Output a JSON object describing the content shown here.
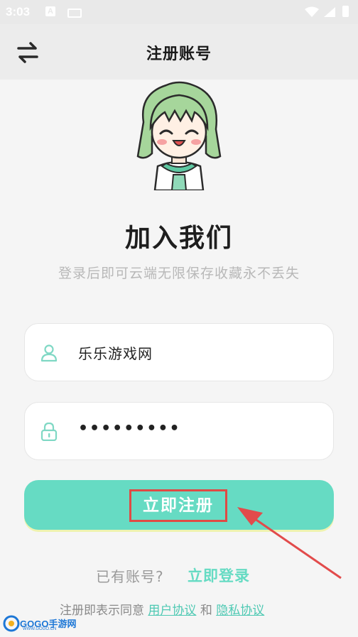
{
  "status_bar": {
    "time": "3:03",
    "a_icon": "A"
  },
  "header": {
    "title": "注册账号",
    "swap_icon": "swap-arrows-icon"
  },
  "hero": {
    "title": "加入我们",
    "subtitle": "登录后即可云端无限保存收藏永不丢失"
  },
  "form": {
    "username_value": "乐乐游戏网",
    "username_icon": "user-icon",
    "password_value": "•••••••••",
    "password_icon": "lock-icon",
    "register_label": "立即注册"
  },
  "footer": {
    "have_account": "已有账号?",
    "login_link": "立即登录",
    "agreement_prefix": "注册即表示同意",
    "user_agreement": "用户协议",
    "and_text": "和",
    "privacy_policy": "隐私协议"
  },
  "watermark": {
    "text": "GOGO手游网",
    "sub": "WWW.GOGO.CN"
  },
  "colors": {
    "accent": "#66dbc3",
    "highlight": "#e04a44",
    "link": "#4ec9b3"
  }
}
